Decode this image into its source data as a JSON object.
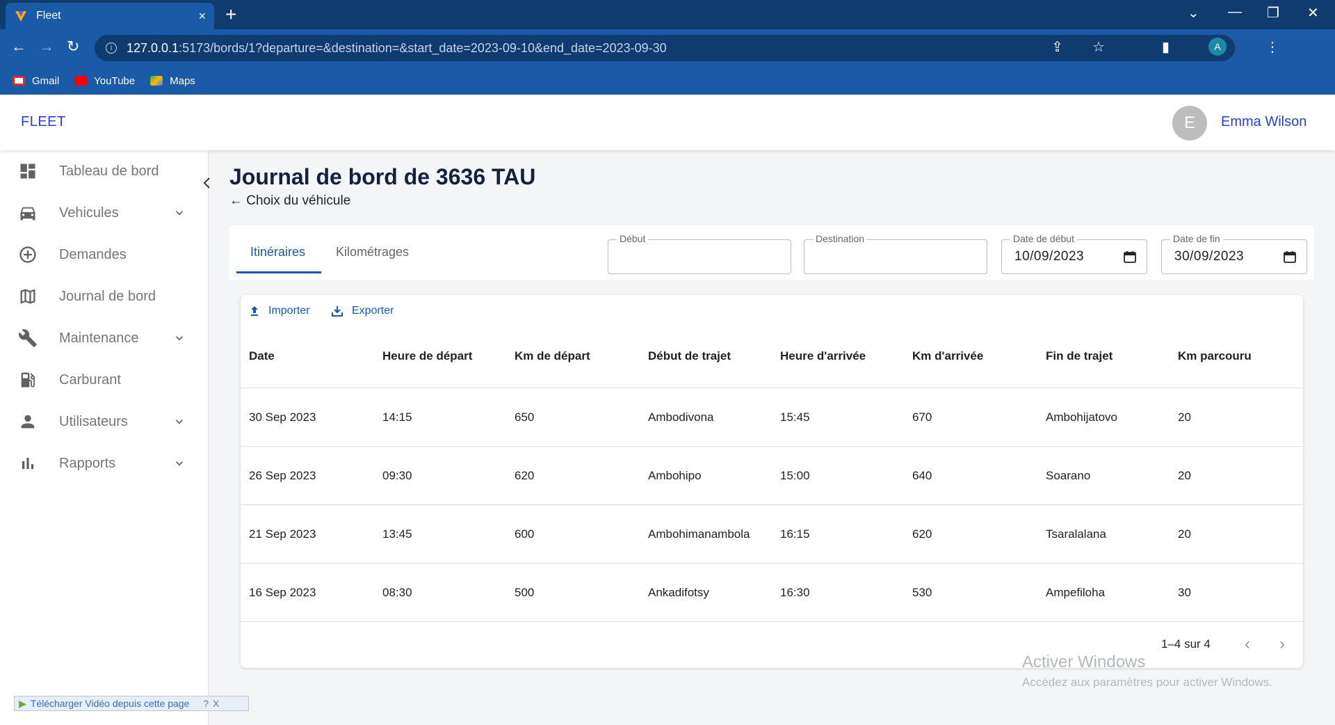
{
  "browser": {
    "tab_title": "Fleet",
    "tab_close": "×",
    "new_tab": "+",
    "url_host": "127.0.0.1",
    "url_path": ":5173/bords/1?departure=&destination=&start_date=2023-09-10&end_date=2023-09-30",
    "profile_initial": "A",
    "bookmarks": [
      {
        "label": "Gmail"
      },
      {
        "label": "YouTube"
      },
      {
        "label": "Maps"
      }
    ]
  },
  "header": {
    "brand": "FLEET",
    "user_initial": "E",
    "user_name": "Emma Wilson"
  },
  "sidebar": {
    "items": [
      {
        "label": "Tableau de bord",
        "icon": "dashboard-icon",
        "expandable": false
      },
      {
        "label": "Vehicules",
        "icon": "car-icon",
        "expandable": true
      },
      {
        "label": "Demandes",
        "icon": "add-circle-icon",
        "expandable": false
      },
      {
        "label": "Journal de bord",
        "icon": "map-icon",
        "expandable": false
      },
      {
        "label": "Maintenance",
        "icon": "wrench-icon",
        "expandable": true
      },
      {
        "label": "Carburant",
        "icon": "fuel-icon",
        "expandable": false
      },
      {
        "label": "Utilisateurs",
        "icon": "person-icon",
        "expandable": true
      },
      {
        "label": "Rapports",
        "icon": "bar-chart-icon",
        "expandable": true
      }
    ]
  },
  "page": {
    "title": "Journal de bord de 3636 TAU",
    "back_link": "← Choix du véhicule"
  },
  "tabs": [
    {
      "label": "Itinéraires",
      "active": true
    },
    {
      "label": "Kilométrages",
      "active": false
    }
  ],
  "filters": {
    "departure": {
      "label": "Début",
      "value": ""
    },
    "destination": {
      "label": "Destination",
      "value": ""
    },
    "start_date": {
      "label": "Date de début",
      "value": "10/09/2023"
    },
    "end_date": {
      "label": "Date de fin",
      "value": "30/09/2023"
    }
  },
  "actions": {
    "import": "Importer",
    "export": "Exporter"
  },
  "table": {
    "columns": [
      "Date",
      "Heure de départ",
      "Km de départ",
      "Début de trajet",
      "Heure d'arrivée",
      "Km d'arrivée",
      "Fin de trajet",
      "Km parcouru"
    ],
    "rows": [
      [
        "30 Sep 2023",
        "14:15",
        "650",
        "Ambodivona",
        "15:45",
        "670",
        "Ambohijatovo",
        "20"
      ],
      [
        "26 Sep 2023",
        "09:30",
        "620",
        "Ambohipo",
        "15:00",
        "640",
        "Soarano",
        "20"
      ],
      [
        "21 Sep 2023",
        "13:45",
        "600",
        "Ambohimanambola",
        "16:15",
        "620",
        "Tsaralalana",
        "20"
      ],
      [
        "16 Sep 2023",
        "08:30",
        "500",
        "Ankadifotsy",
        "16:30",
        "530",
        "Ampefiloha",
        "30"
      ]
    ]
  },
  "pagination": {
    "text": "1–4 sur 4"
  },
  "watermark": {
    "title": "Activer Windows",
    "subtitle": "Accédez aux paramètres pour activer Windows."
  },
  "download_bar": {
    "label": "Télécharger Vidéo depuis cette page",
    "help": "?",
    "close": "X"
  },
  "colors": {
    "accent": "#1e57b2",
    "brand": "#2a3fd6",
    "chrome": "#1a5aa6"
  }
}
